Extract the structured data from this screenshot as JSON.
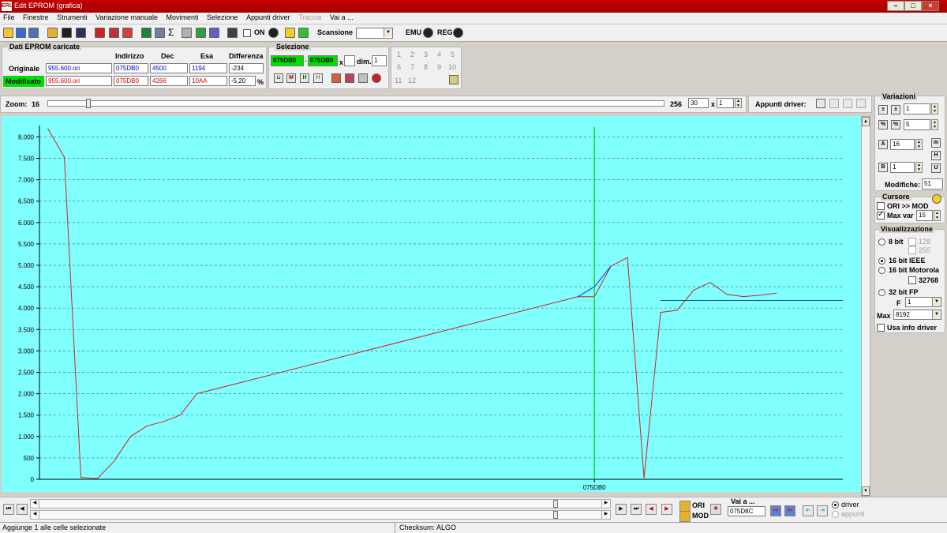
{
  "window": {
    "title": "Edit EPROM (grafica)",
    "app_icon": "ERL"
  },
  "menu": [
    "File",
    "Finestre",
    "Strumenti",
    "Variazione manuale",
    "Movimenti",
    "Selezione",
    "Appunti driver",
    "Traccia",
    "Vai a ..."
  ],
  "toolbar": {
    "on_label": "ON",
    "scansione_label": "Scansione",
    "scansione_value": "",
    "emu_label": "EMU",
    "reg_label": "REG"
  },
  "dati": {
    "title": "Dati EPROM caricate",
    "headers": {
      "indirizzo": "Indirizzo",
      "dec": "Dec",
      "esa": "Esa",
      "differenza": "Differenza"
    },
    "originale": {
      "label": "Originale",
      "file": "955.600.ori",
      "indirizzo": "075DB0",
      "dec": "4500",
      "esa": "1194",
      "diff": "-234"
    },
    "modificato": {
      "label": "Modificato",
      "file": "955.600.ori",
      "indirizzo": "075DB0",
      "dec": "4266",
      "esa": "10AA",
      "diff": "-5,20",
      "pct": "%"
    }
  },
  "selezione": {
    "title": "Selezione",
    "from": "075DB0",
    "to": "075DB0",
    "x": "x",
    "x_value": "",
    "dim_label": "dim.",
    "dim_value": "1",
    "dash": "-"
  },
  "numgrid": [
    "1",
    "2",
    "3",
    "4",
    "5",
    "6",
    "7",
    "8",
    "9",
    "10",
    "11",
    "12"
  ],
  "zoom": {
    "label": "Zoom:",
    "min": "16",
    "max": "256",
    "value": "30",
    "x_label": "x",
    "x_value": "1",
    "level": 0.16
  },
  "appunti": {
    "label": "Appunti driver:"
  },
  "variazioni": {
    "title": "Variazioni",
    "v1": "1",
    "v2": "5",
    "v3": "16",
    "v4": "1",
    "modifiche_label": "Modifiche:",
    "modifiche_value": "51"
  },
  "cursore": {
    "title": "Cursore",
    "ori_mod": "ORI >> MOD",
    "maxvar_label": "Max var",
    "maxvar_value": "15"
  },
  "visualizzazione": {
    "title": "Visualizzazione",
    "bit8": "8 bit",
    "v128": "128",
    "v255": "255",
    "bit16ieee": "16 bit IEEE",
    "bit16moto": "16 bit Motorola",
    "v32768": "32768",
    "bit32": "32 bit FP",
    "f_label": "F",
    "f_value": "1",
    "max_label": "Max",
    "max_value": "8192",
    "usa_info": "Usa info driver"
  },
  "bottom": {
    "ori": "ORI",
    "mod": "MOD",
    "vai_label": "Vai a ...",
    "vai_value": "075D8C",
    "driver": "driver",
    "appunti": "appunti"
  },
  "status": {
    "left": "Aggiunge 1 alle celle selezionate",
    "checksum": "Checksum: ALGO"
  },
  "chart_data": {
    "type": "line",
    "x_tick": "075DB0",
    "ylim": [
      0,
      8192
    ],
    "yticks": [
      "0",
      "500",
      "1.000",
      "1.500",
      "2.000",
      "2.500",
      "3.000",
      "3.500",
      "4.000",
      "4.500",
      "5.000",
      "5.500",
      "6.000",
      "6.500",
      "7.000",
      "7.500",
      "8.000"
    ],
    "grid": true,
    "colors": {
      "bg": "#80ffff",
      "red": "#d22020",
      "blue": "#1030ff",
      "cursor": "#00cc00",
      "ref": "#1050a0"
    },
    "series": [
      {
        "values": [
          [
            0,
            8200
          ],
          [
            1,
            7530
          ],
          [
            2,
            40
          ],
          [
            3,
            20
          ],
          [
            4,
            420
          ],
          [
            5,
            1000
          ],
          [
            6,
            1250
          ],
          [
            7,
            1350
          ],
          [
            8,
            1500
          ],
          [
            9,
            2000
          ],
          [
            32,
            4266
          ],
          [
            33,
            4266
          ],
          [
            34,
            4980
          ],
          [
            35,
            5180
          ],
          [
            36,
            20
          ],
          [
            37,
            3900
          ],
          [
            38,
            3950
          ],
          [
            39,
            4420
          ],
          [
            40,
            4600
          ],
          [
            41,
            4320
          ],
          [
            42,
            4270
          ],
          [
            43,
            4300
          ],
          [
            44,
            4350
          ]
        ]
      },
      {
        "values": [
          [
            32,
            4266
          ],
          [
            33,
            4500
          ],
          [
            34,
            4980
          ]
        ]
      }
    ],
    "reference": {
      "value": 4180,
      "from": 37,
      "to": 48
    },
    "cursor_x": 33,
    "x_range": [
      -0.5,
      48
    ]
  }
}
